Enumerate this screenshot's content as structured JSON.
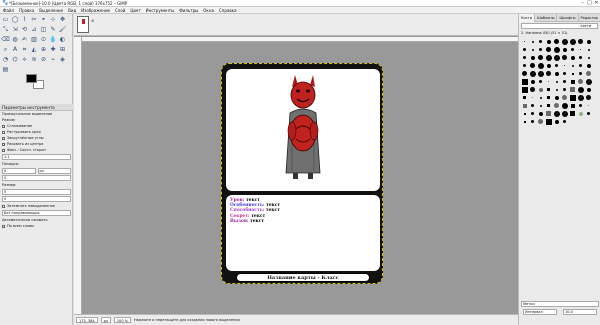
{
  "window": {
    "title": "*[Безымянное]-10.0 (Цвета RGB, 1 слой) 376x752 – GIMP",
    "minimize": "–",
    "maximize": "□",
    "close": "✕"
  },
  "menu": [
    "Файл",
    "Правка",
    "Выделение",
    "Вид",
    "Изображение",
    "Слой",
    "Цвет",
    "Инструменты",
    "Фильтры",
    "Окна",
    "Справка"
  ],
  "toolbox": {
    "tools": [
      "▭",
      "◯",
      "⌇",
      "✂",
      "⌖",
      "⊹",
      "✥",
      "⤡",
      "⇲",
      "⟲",
      "⊿",
      "◫",
      "✎",
      "🖌",
      "⌫",
      "◍",
      "✍",
      "▥",
      "⊙",
      "💧",
      "◐",
      "⌕",
      "A",
      "⌗",
      "◭",
      "⊕",
      "✚",
      "⊞",
      "◔",
      "⌬",
      "⟡",
      "≋",
      "⊘",
      "⌁",
      "◈",
      "▤"
    ],
    "fg_color": "#000000",
    "bg_color": "#ffffff"
  },
  "tool_options": {
    "tab_label": "Параметры инструмента",
    "section": "Прямоугольное выделение",
    "mode_label": "Режим:",
    "antialias": "Сглаживание",
    "feather": "Растушевать края",
    "rounded": "Закруглённые углы",
    "expand": "Рисовать из центра",
    "fixed_label": "Фикс.: Соотн. сторон",
    "fixed_value": "1:1",
    "position_label": "Позиция:",
    "position_unit": "px",
    "pos_x": "0",
    "pos_y": "0",
    "size_label": "Размер:",
    "size_w": "0",
    "size_h": "0",
    "highlight": "Затемнять невыделенное",
    "guides_label": "Без направляющих",
    "autoshrink": "Автоматически сжимать",
    "shrink_merged": "По всем слоям"
  },
  "canvas": {
    "card": {
      "stats": [
        {
          "label": "Урон:",
          "value": "текст",
          "color": "#b4149a"
        },
        {
          "label": "Особенность:",
          "value": "текст",
          "color": "#4233d6"
        },
        {
          "label": "Способность:",
          "value": "текст",
          "color": "#a434c8"
        },
        {
          "label": "Секрет:",
          "value": "текст",
          "color": "#d12b8f"
        },
        {
          "label": "Вызов:",
          "value": "текст",
          "color": "#a01a9b"
        }
      ],
      "name_bar": "Название карты - Класс"
    }
  },
  "status": {
    "coords": "175, 384",
    "unit": "px",
    "zoom": "100 %",
    "message": "Нажмите и перетащите для создания нового выделения"
  },
  "dock": {
    "tabs": [
      "Кисти",
      "Шаблоны",
      "Шрифты",
      "Редактор кисти"
    ],
    "brush_name": "2. Hardness 050 (51 × 51)",
    "bottom_tag": "Метки",
    "spacing_label": "Интервал",
    "spacing_value": "10.0"
  }
}
